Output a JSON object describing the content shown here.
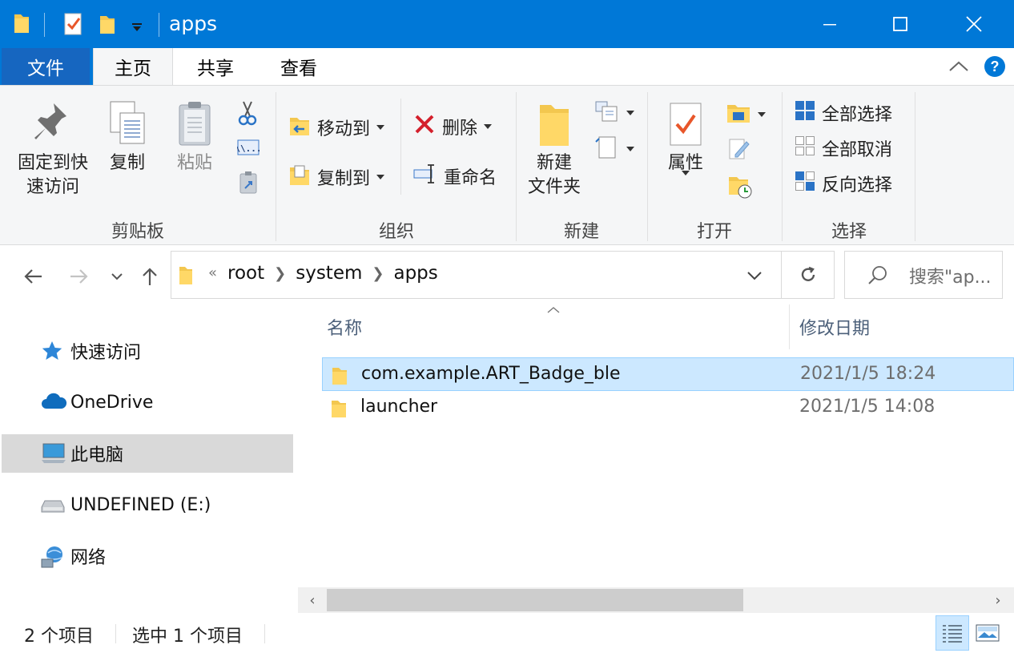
{
  "window": {
    "title": "apps",
    "accent": "#0078d7"
  },
  "ribbon_tabs": [
    {
      "label": "文件"
    },
    {
      "label": "主页"
    },
    {
      "label": "共享"
    },
    {
      "label": "查看"
    }
  ],
  "ribbon": {
    "clipboard": {
      "pin_label_1": "固定到快",
      "pin_label_2": "速访问",
      "copy_label": "复制",
      "paste_label": "粘贴",
      "group_label": "剪贴板"
    },
    "organize": {
      "move_to_label": "移动到",
      "copy_to_label": "复制到",
      "delete_label": "删除",
      "rename_label": "重命名",
      "group_label": "组织"
    },
    "new": {
      "new_folder_label_1": "新建",
      "new_folder_label_2": "文件夹",
      "group_label": "新建"
    },
    "open": {
      "properties_label": "属性",
      "group_label": "打开"
    },
    "select": {
      "select_all_label": "全部选择",
      "select_none_label": "全部取消",
      "invert_selection_label": "反向选择",
      "group_label": "选择"
    }
  },
  "address": {
    "overflow": "«",
    "crumbs": [
      "root",
      "system",
      "apps"
    ],
    "search_placeholder": "搜索\"ap..."
  },
  "nav_pane": {
    "items": [
      {
        "label": "快速访问",
        "icon": "star-icon"
      },
      {
        "label": "OneDrive",
        "icon": "cloud-icon"
      },
      {
        "label": "此电脑",
        "icon": "computer-icon"
      },
      {
        "label": "UNDEFINED (E:)",
        "icon": "drive-icon"
      },
      {
        "label": "网络",
        "icon": "network-icon"
      }
    ]
  },
  "file_list": {
    "columns": [
      "名称",
      "修改日期"
    ],
    "rows": [
      {
        "name": "com.example.ART_Badge_ble",
        "modified": "2021/1/5 18:24",
        "selected": true
      },
      {
        "name": "launcher",
        "modified": "2021/1/5 14:08",
        "selected": false
      }
    ]
  },
  "status": {
    "item_count": "2 个项目",
    "selection": "选中 1 个项目"
  }
}
